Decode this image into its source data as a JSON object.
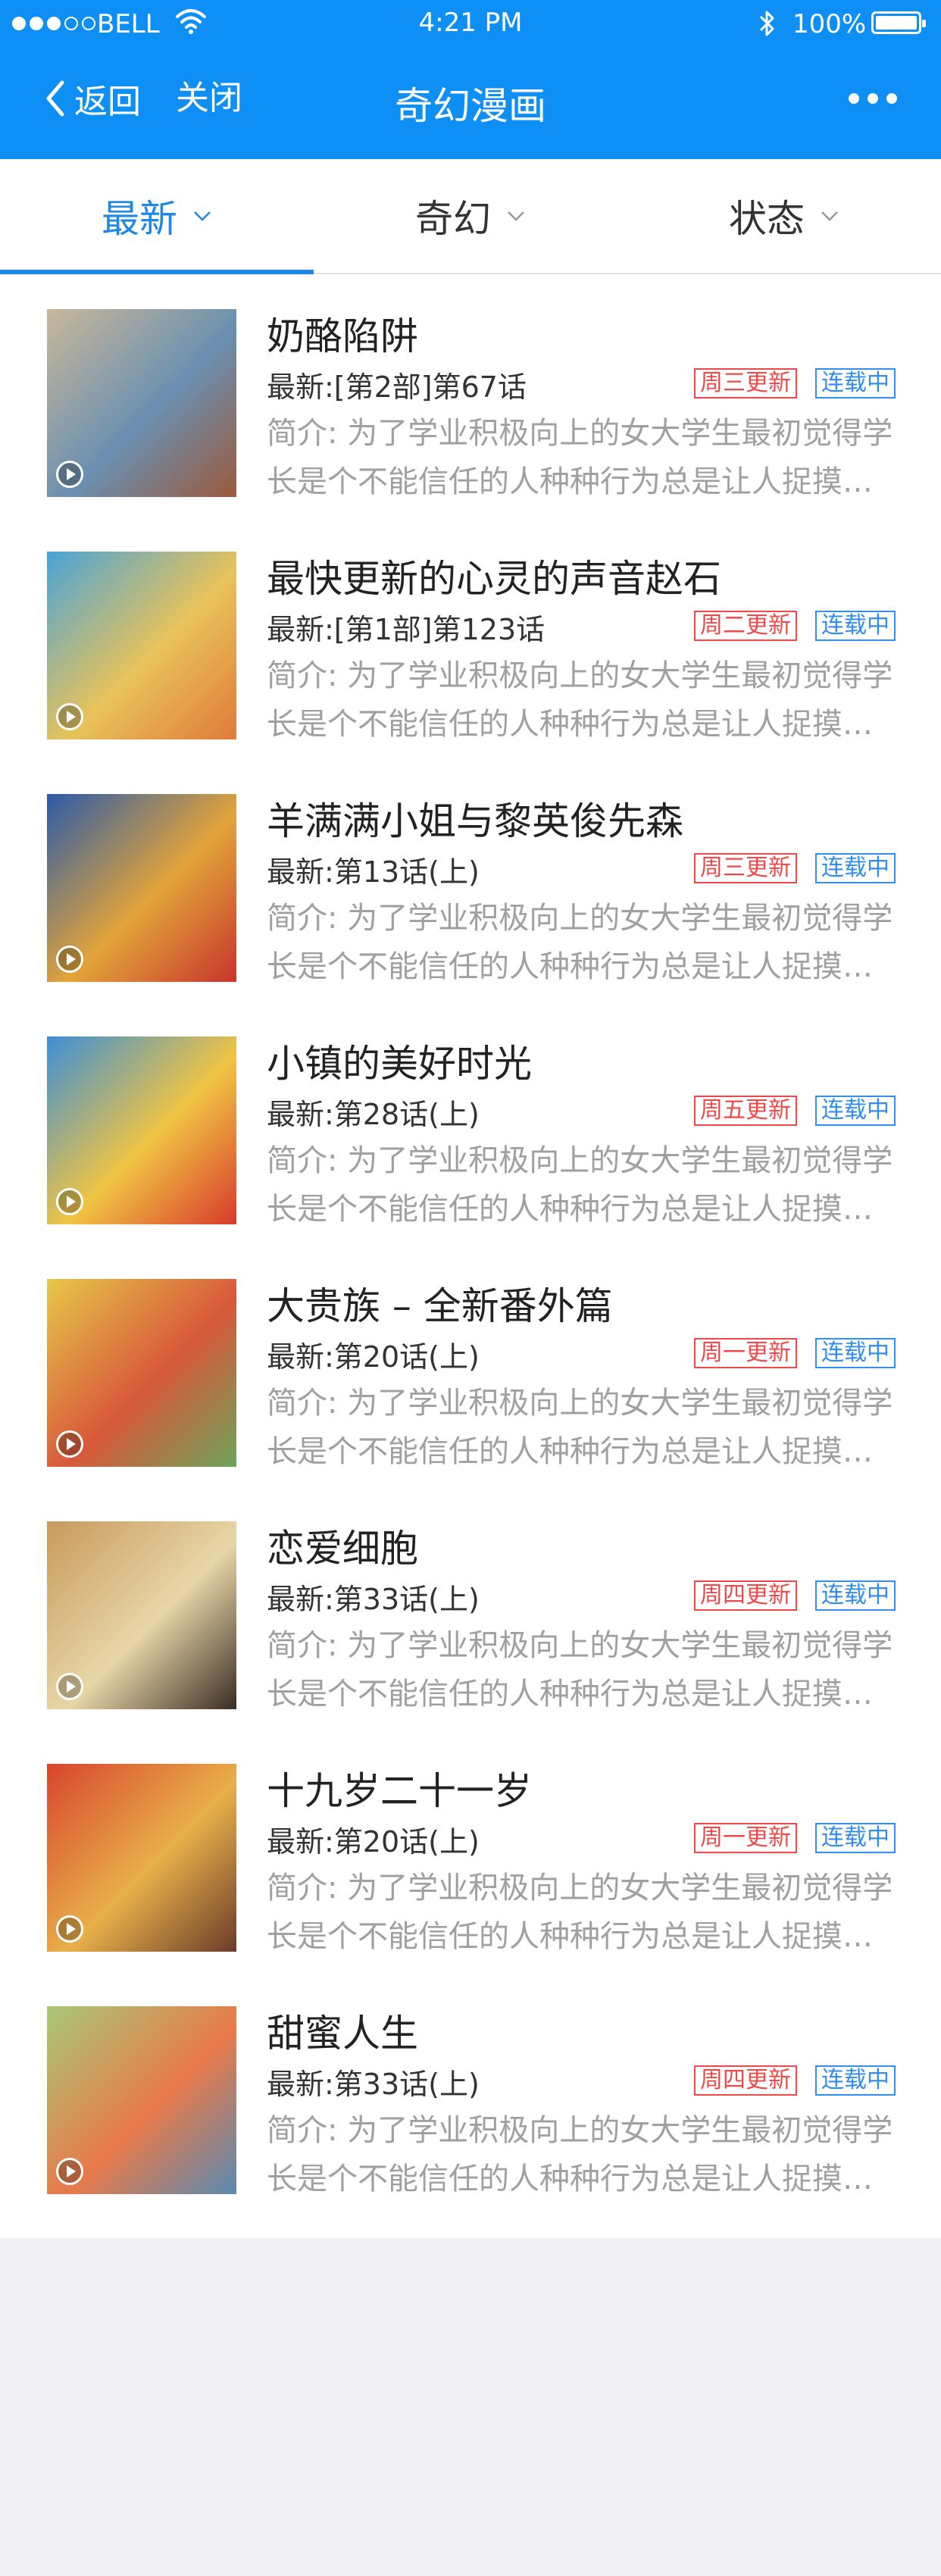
{
  "status_bar": {
    "carrier": "BELL",
    "time": "4:21 PM",
    "battery": "100%"
  },
  "nav": {
    "back_label": "返回",
    "close_label": "关闭",
    "title": "奇幻漫画"
  },
  "tabs": [
    {
      "label": "最新",
      "active": true
    },
    {
      "label": "奇幻",
      "active": false
    },
    {
      "label": "状态",
      "active": false
    }
  ],
  "colors": {
    "header": "#0d8ff5",
    "accent": "#1e88e5",
    "schedule_badge": "#f04848",
    "status_badge": "#2f8ef0"
  },
  "items": [
    {
      "title": "奶酪陷阱",
      "latest": "最新:[第2部]第67话",
      "schedule": "周三更新",
      "status": "连载中",
      "desc": "简介: 为了学业积极向上的女大学生最初觉得学长是个不能信任的人种种行为总是让人捉摸不透",
      "cover_colors": [
        "#c9b79a",
        "#6a8fb0",
        "#9b5a3c"
      ]
    },
    {
      "title": "最快更新的心灵的声音赵石",
      "latest": "最新:[第1部]第123话",
      "schedule": "周二更新",
      "status": "连载中",
      "desc": "简介: 为了学业积极向上的女大学生最初觉得学长是个不能信任的人种种行为总是让人捉摸不透",
      "cover_colors": [
        "#4aa3d8",
        "#e8c35a",
        "#e07a3a"
      ]
    },
    {
      "title": "羊满满小姐与黎英俊先森",
      "latest": "最新:第13话(上)",
      "schedule": "周三更新",
      "status": "连载中",
      "desc": "简介: 为了学业积极向上的女大学生最初觉得学长是个不能信任的人种种行为总是让人捉摸不透",
      "cover_colors": [
        "#2c5aa8",
        "#e2a43a",
        "#c8342c"
      ]
    },
    {
      "title": "小镇的美好时光",
      "latest": "最新:第28话(上)",
      "schedule": "周五更新",
      "status": "连载中",
      "desc": "简介: 为了学业积极向上的女大学生最初觉得学长是个不能信任的人种种行为总是让人捉摸不透",
      "cover_colors": [
        "#3d8fd6",
        "#f0c443",
        "#d83a2c"
      ]
    },
    {
      "title": "大贵族 – 全新番外篇",
      "latest": "最新:第20话(上)",
      "schedule": "周一更新",
      "status": "连载中",
      "desc": "简介: 为了学业积极向上的女大学生最初觉得学长是个不能信任的人种种行为总是让人捉摸不透",
      "cover_colors": [
        "#e6c84a",
        "#d8583a",
        "#6da45a"
      ]
    },
    {
      "title": "恋爱细胞",
      "latest": "最新:第33话(上)",
      "schedule": "周四更新",
      "status": "连载中",
      "desc": "简介: 为了学业积极向上的女大学生最初觉得学长是个不能信任的人种种行为总是让人捉摸不透",
      "cover_colors": [
        "#c89a5c",
        "#e8d6a8",
        "#3a2c24"
      ]
    },
    {
      "title": "十九岁二十一岁",
      "latest": "最新:第20话(上)",
      "schedule": "周一更新",
      "status": "连载中",
      "desc": "简介: 为了学业积极向上的女大学生最初觉得学长是个不能信任的人种种行为总是让人捉摸不透",
      "cover_colors": [
        "#d8452e",
        "#e8b04a",
        "#6a3c2a"
      ]
    },
    {
      "title": "甜蜜人生",
      "latest": "最新:第33话(上)",
      "schedule": "周四更新",
      "status": "连载中",
      "desc": "简介: 为了学业积极向上的女大学生最初觉得学长是个不能信任的人种种行为总是让人捉摸不透",
      "cover_colors": [
        "#a8c878",
        "#e87a4a",
        "#5a8ab0"
      ]
    }
  ]
}
